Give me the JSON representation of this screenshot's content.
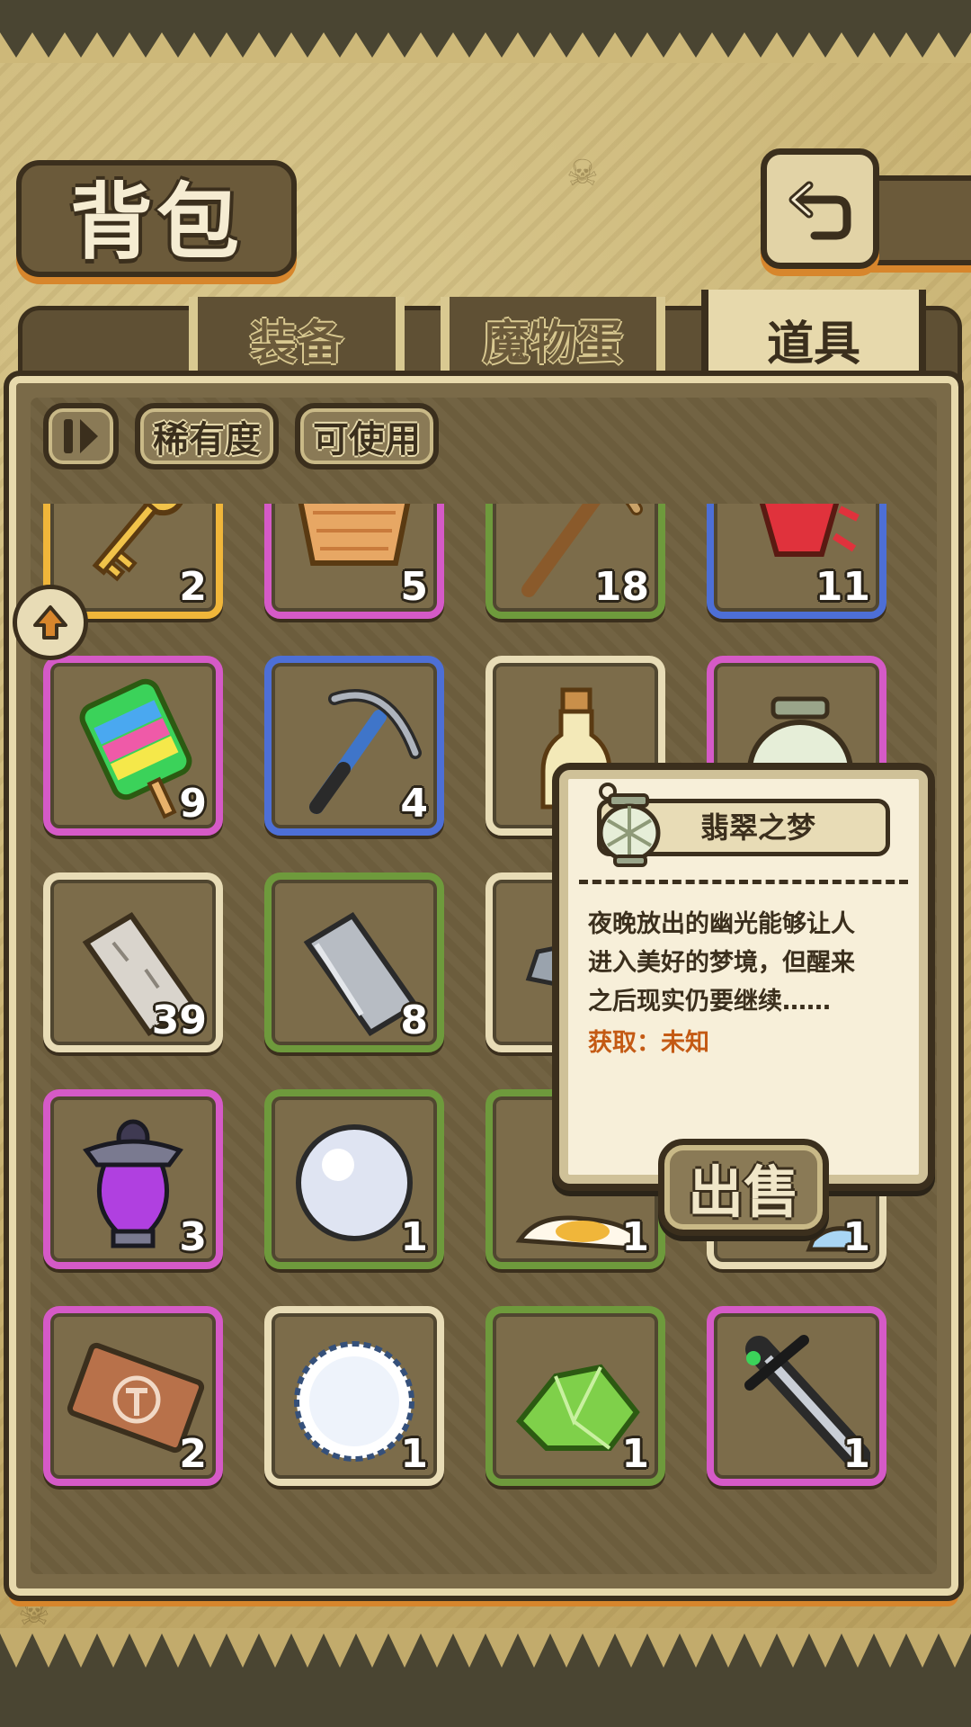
{
  "header": {
    "title": "背包"
  },
  "tabs": [
    {
      "label": "装备",
      "active": false
    },
    {
      "label": "魔物蛋",
      "active": false
    },
    {
      "label": "道具",
      "active": true
    }
  ],
  "filters": {
    "rarity_label": "稀有度",
    "usable_label": "可使用"
  },
  "rarity_colors": {
    "white": "#e8dcb6",
    "green": "#6e9a3c",
    "blue": "#4d6fd6",
    "purple": "#d55ac7",
    "orange": "#f0b63a"
  },
  "inventory": {
    "items": [
      {
        "icon": "key-icon",
        "count": "2",
        "rarity": "orange"
      },
      {
        "icon": "bread-basket-icon",
        "count": "5",
        "rarity": "purple"
      },
      {
        "icon": "wooden-pickaxe-icon",
        "count": "18",
        "rarity": "green"
      },
      {
        "icon": "red-gem-icon",
        "count": "11",
        "rarity": "blue"
      },
      {
        "icon": "rainbow-popsicle-icon",
        "count": "9",
        "rarity": "purple"
      },
      {
        "icon": "iron-pickaxe-icon",
        "count": "4",
        "rarity": "blue"
      },
      {
        "icon": "potion-bottle-icon",
        "count": "",
        "rarity": "white"
      },
      {
        "icon": "lantern-icon",
        "count": "",
        "rarity": "purple"
      },
      {
        "icon": "stone-bar-icon",
        "count": "39",
        "rarity": "white"
      },
      {
        "icon": "metal-bar-icon",
        "count": "8",
        "rarity": "green"
      },
      {
        "icon": "ore-icon",
        "count": "",
        "rarity": "white"
      },
      {
        "icon": "hidden-item-icon",
        "count": "",
        "rarity": "white"
      },
      {
        "icon": "purple-vase-icon",
        "count": "3",
        "rarity": "purple"
      },
      {
        "icon": "pearl-icon",
        "count": "1",
        "rarity": "green"
      },
      {
        "icon": "fried-egg-icon",
        "count": "1",
        "rarity": "green"
      },
      {
        "icon": "ice-item-icon",
        "count": "1",
        "rarity": "white"
      },
      {
        "icon": "hammer-ticket-icon",
        "count": "2",
        "rarity": "purple"
      },
      {
        "icon": "snowball-icon",
        "count": "1",
        "rarity": "white"
      },
      {
        "icon": "green-crystal-icon",
        "count": "1",
        "rarity": "green"
      },
      {
        "icon": "dark-sword-icon",
        "count": "1",
        "rarity": "purple"
      }
    ]
  },
  "tooltip": {
    "name": "翡翠之梦",
    "icon": "lantern-icon",
    "description_lines": [
      "夜晚放出的幽光能够让人",
      "进入美好的梦境，但醒来",
      "之后现实仍要继续……"
    ],
    "source": "获取：未知",
    "sell_label": "出售"
  }
}
